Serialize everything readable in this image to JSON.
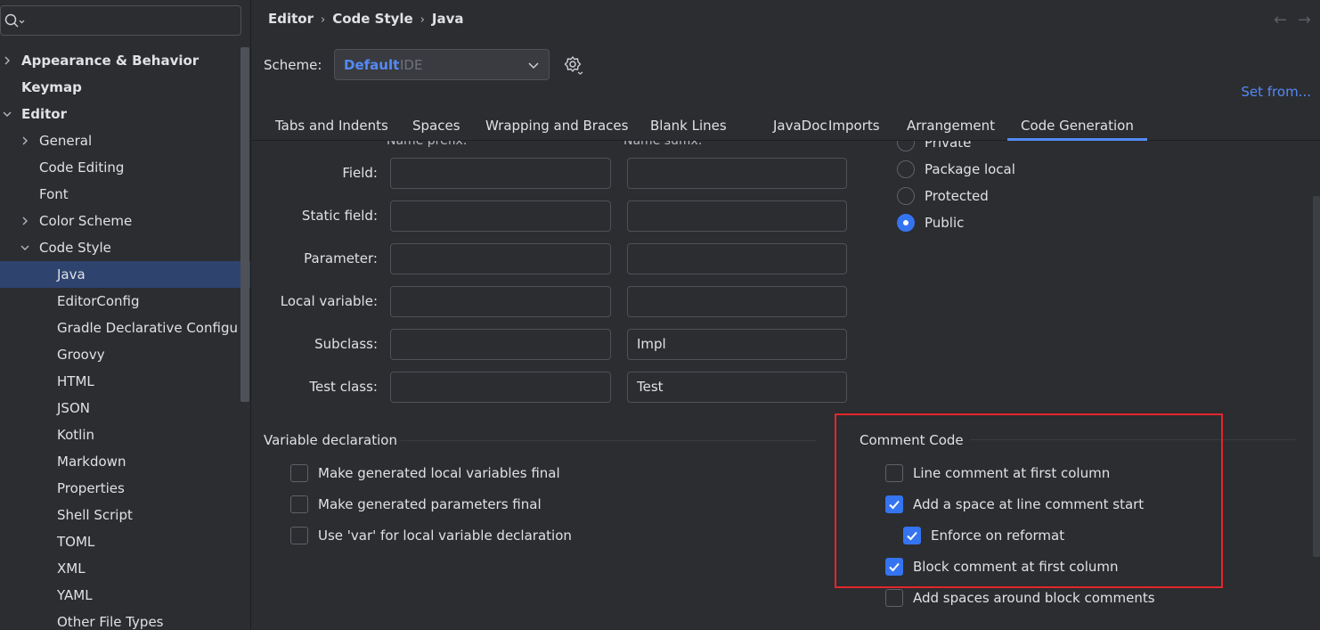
{
  "sidebar": {
    "search_placeholder": "",
    "items": [
      {
        "label": "Appearance & Behavior",
        "bold": true,
        "arrow": "chevron-right-icon",
        "indent": 0
      },
      {
        "label": "Keymap",
        "bold": true,
        "arrow": null,
        "indent": 0
      },
      {
        "label": "Editor",
        "bold": true,
        "arrow": "chevron-down-icon",
        "indent": 0
      },
      {
        "label": "General",
        "bold": false,
        "arrow": "chevron-right-icon",
        "indent": 1
      },
      {
        "label": "Code Editing",
        "bold": false,
        "arrow": null,
        "indent": 1
      },
      {
        "label": "Font",
        "bold": false,
        "arrow": null,
        "indent": 1
      },
      {
        "label": "Color Scheme",
        "bold": false,
        "arrow": "chevron-right-icon",
        "indent": 1
      },
      {
        "label": "Code Style",
        "bold": false,
        "arrow": "chevron-down-icon",
        "indent": 1
      },
      {
        "label": "Java",
        "bold": false,
        "arrow": null,
        "indent": 2,
        "selected": true
      },
      {
        "label": "EditorConfig",
        "bold": false,
        "arrow": null,
        "indent": 2
      },
      {
        "label": "Gradle Declarative Configu",
        "bold": false,
        "arrow": null,
        "indent": 2
      },
      {
        "label": "Groovy",
        "bold": false,
        "arrow": null,
        "indent": 2
      },
      {
        "label": "HTML",
        "bold": false,
        "arrow": null,
        "indent": 2
      },
      {
        "label": "JSON",
        "bold": false,
        "arrow": null,
        "indent": 2
      },
      {
        "label": "Kotlin",
        "bold": false,
        "arrow": null,
        "indent": 2
      },
      {
        "label": "Markdown",
        "bold": false,
        "arrow": null,
        "indent": 2
      },
      {
        "label": "Properties",
        "bold": false,
        "arrow": null,
        "indent": 2
      },
      {
        "label": "Shell Script",
        "bold": false,
        "arrow": null,
        "indent": 2
      },
      {
        "label": "TOML",
        "bold": false,
        "arrow": null,
        "indent": 2
      },
      {
        "label": "XML",
        "bold": false,
        "arrow": null,
        "indent": 2
      },
      {
        "label": "YAML",
        "bold": false,
        "arrow": null,
        "indent": 2
      },
      {
        "label": "Other File Types",
        "bold": false,
        "arrow": null,
        "indent": 2
      }
    ]
  },
  "header": {
    "breadcrumb": [
      "Editor",
      "Code Style",
      "Java"
    ],
    "back_icon": "arrow-left-icon",
    "forward_icon": "arrow-right-icon"
  },
  "scheme": {
    "label": "Scheme:",
    "name": "Default",
    "kind": "IDE",
    "gear_icon": "gear-icon",
    "set_from": "Set from..."
  },
  "tabs": [
    {
      "label": "Tabs and Indents",
      "active": false
    },
    {
      "label": "Spaces",
      "active": false
    },
    {
      "label": "Wrapping and Braces",
      "active": false
    },
    {
      "label": "Blank Lines",
      "active": false
    },
    {
      "label": "JavaDoc",
      "active": false
    },
    {
      "label": "Imports",
      "active": false
    },
    {
      "label": "Arrangement",
      "active": false
    },
    {
      "label": "Code Generation",
      "active": true
    }
  ],
  "naming": {
    "prefix_header": "Name prefix:",
    "suffix_header": "Name suffix:",
    "rows": [
      {
        "label": "Field:",
        "prefix": "",
        "suffix": ""
      },
      {
        "label": "Static field:",
        "prefix": "",
        "suffix": ""
      },
      {
        "label": "Parameter:",
        "prefix": "",
        "suffix": ""
      },
      {
        "label": "Local variable:",
        "prefix": "",
        "suffix": ""
      },
      {
        "label": "Subclass:",
        "prefix": "",
        "suffix": "Impl"
      },
      {
        "label": "Test class:",
        "prefix": "",
        "suffix": "Test"
      }
    ]
  },
  "visibility": {
    "options": [
      {
        "label": "Private",
        "selected": false
      },
      {
        "label": "Package local",
        "selected": false
      },
      {
        "label": "Protected",
        "selected": false
      },
      {
        "label": "Public",
        "selected": true
      }
    ]
  },
  "variable_declaration": {
    "title": "Variable declaration",
    "options": [
      {
        "label": "Make generated local variables final",
        "checked": false
      },
      {
        "label": "Make generated parameters final",
        "checked": false
      },
      {
        "label": "Use 'var' for local variable declaration",
        "checked": false
      }
    ]
  },
  "comment_code": {
    "title": "Comment Code",
    "options": [
      {
        "label": "Line comment at first column",
        "checked": false,
        "indent": 0
      },
      {
        "label": "Add a space at line comment start",
        "checked": true,
        "indent": 0
      },
      {
        "label": "Enforce on reformat",
        "checked": true,
        "indent": 1
      },
      {
        "label": "Block comment at first column",
        "checked": true,
        "indent": 0
      },
      {
        "label": "Add spaces around block comments",
        "checked": false,
        "indent": 0
      }
    ]
  },
  "colors": {
    "accent": "#548af7",
    "checkbox_on": "#3574f0",
    "selection": "#2e436e",
    "highlight_border": "#e3262b"
  }
}
